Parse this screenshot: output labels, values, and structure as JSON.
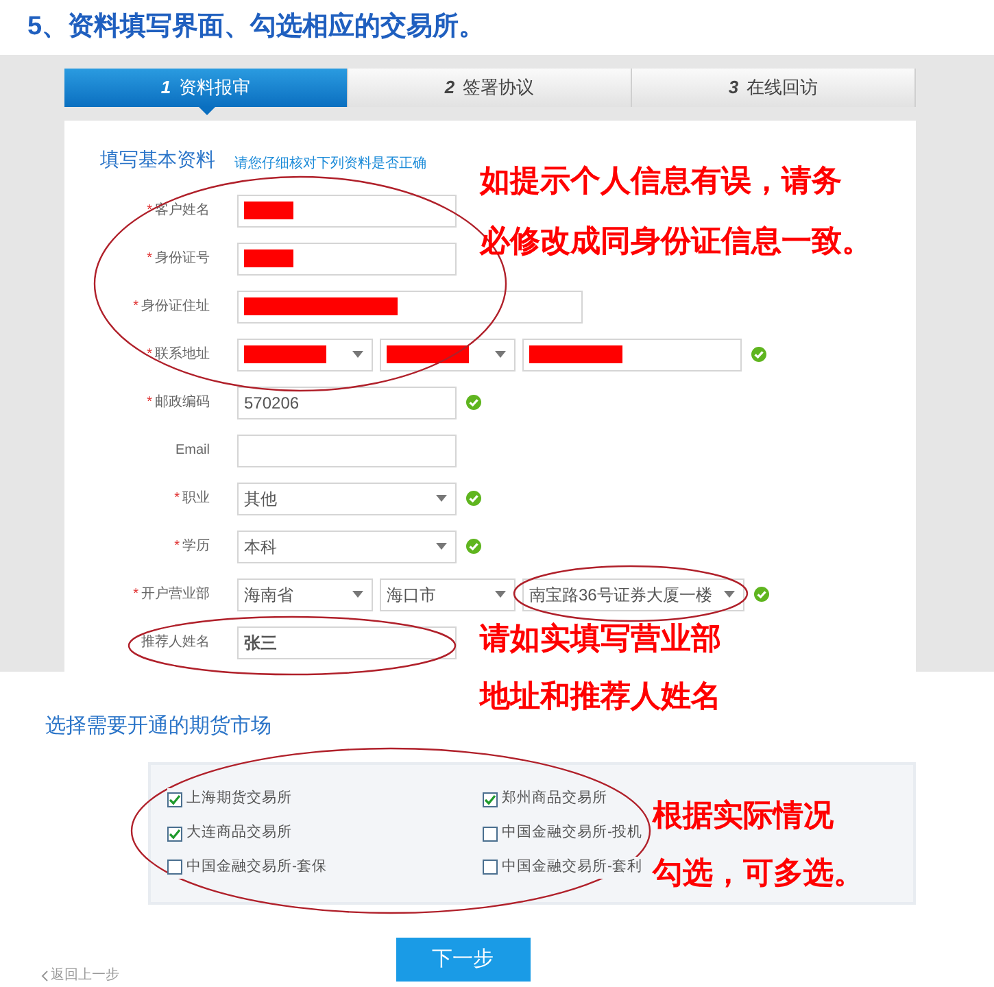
{
  "heading": "5、资料填写界面、勾选相应的交易所。",
  "steps": [
    {
      "number": "1",
      "label": "资料报审",
      "selected": true
    },
    {
      "number": "2",
      "label": "签署协议",
      "selected": false
    },
    {
      "number": "3",
      "label": "在线回访",
      "selected": false
    }
  ],
  "form": {
    "title": "填写基本资料",
    "hint": "请您仔细核对下列资料是否正确",
    "fields": [
      {
        "label": "客户姓名",
        "marker": "*",
        "valid": false,
        "controls": [
          {
            "kind": "input",
            "redacted": true
          }
        ]
      },
      {
        "label": "身份证号",
        "marker": "*",
        "valid": false,
        "controls": [
          {
            "kind": "input",
            "redacted": true
          }
        ]
      },
      {
        "label": "身份证住址",
        "marker": "*",
        "valid": false,
        "controls": [
          {
            "kind": "wide-input",
            "redacted": true
          }
        ]
      },
      {
        "label": "联系地址",
        "marker": "*",
        "valid": true,
        "controls": [
          {
            "kind": "select",
            "redacted": true
          },
          {
            "kind": "select",
            "redacted": true
          },
          {
            "kind": "long-input",
            "redacted": true
          }
        ]
      },
      {
        "label": "邮政编码",
        "marker": "*",
        "valid": true,
        "controls": [
          {
            "kind": "input",
            "value": "570206"
          }
        ]
      },
      {
        "label": "Email",
        "valid": false,
        "controls": [
          {
            "kind": "input"
          }
        ]
      },
      {
        "label": "职业",
        "marker": "*",
        "valid": true,
        "controls": [
          {
            "kind": "wide-select",
            "value": "其他"
          }
        ]
      },
      {
        "label": "学历",
        "marker": "*",
        "valid": true,
        "controls": [
          {
            "kind": "wide-select",
            "value": "本科"
          }
        ]
      },
      {
        "label": "开户营业部",
        "marker": "*",
        "valid": true,
        "controls": [
          {
            "kind": "select",
            "value": "海南省"
          },
          {
            "kind": "select",
            "value": "海口市"
          },
          {
            "kind": "long-select",
            "value": "南宝路36号证券大厦一楼"
          }
        ]
      },
      {
        "label": "推荐人姓名",
        "valid": false,
        "controls": [
          {
            "kind": "input",
            "value": "张三",
            "bold": true
          }
        ]
      }
    ]
  },
  "markets": {
    "title": "选择需要开通的期货市场",
    "items": [
      {
        "label": "上海期货交易所",
        "checked": true
      },
      {
        "label": "郑州商品交易所",
        "checked": true
      },
      {
        "label": "大连商品交易所",
        "checked": true
      },
      {
        "label": "中国金融交易所-投机",
        "checked": false
      },
      {
        "label": "中国金融交易所-套保",
        "checked": false
      },
      {
        "label": "中国金融交易所-套利",
        "checked": false
      }
    ]
  },
  "next_button": "下一步",
  "back_link": "返回上一步",
  "annotations": [
    {
      "lines": [
        "如提示个人信息有误，请务",
        "必修改成同身份证信息一致。"
      ]
    },
    {
      "lines": [
        "请如实填写营业部",
        "地址和推荐人姓名"
      ]
    },
    {
      "lines": [
        "根据实际情况",
        "勾选，可多选。"
      ]
    }
  ]
}
